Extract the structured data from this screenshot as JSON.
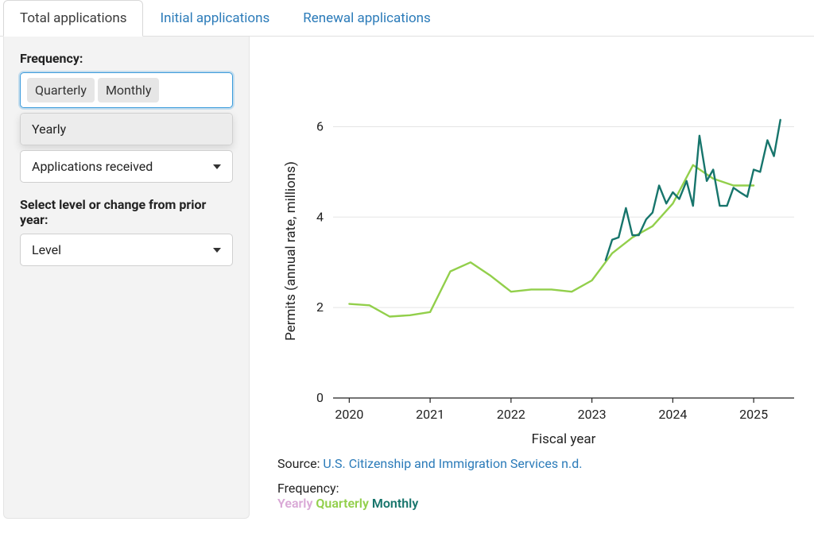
{
  "tabs": {
    "total": "Total applications",
    "initial": "Initial applications",
    "renewal": "Renewal applications"
  },
  "sidebar": {
    "frequency_label": "Frequency:",
    "chips": {
      "quarterly": "Quarterly",
      "monthly": "Monthly"
    },
    "dropdown_option": "Yearly",
    "series_select": "Applications received",
    "level_label": "Select level or change from prior year:",
    "level_value": "Level"
  },
  "chart": {
    "ylabel": "Permits (annual rate, millions)",
    "xlabel": "Fiscal year",
    "source_prefix": "Source: ",
    "source_link": "U.S. Citizenship and Immigration Services n.d.",
    "legend_label": "Frequency:",
    "legend_yearly": "Yearly",
    "legend_quarterly": "Quarterly",
    "legend_monthly": "Monthly"
  },
  "chart_data": {
    "type": "line",
    "xlabel": "Fiscal year",
    "ylabel": "Permits (annual rate, millions)",
    "x_ticks": [
      2020,
      2021,
      2022,
      2023,
      2024,
      2025
    ],
    "y_ticks": [
      0,
      2,
      4,
      6
    ],
    "xlim": [
      2019.8,
      2025.5
    ],
    "ylim": [
      0,
      6.5
    ],
    "series": [
      {
        "name": "Quarterly",
        "color": "#92cf4b",
        "x": [
          2020.0,
          2020.25,
          2020.5,
          2020.75,
          2021.0,
          2021.25,
          2021.5,
          2021.75,
          2022.0,
          2022.25,
          2022.5,
          2022.75,
          2023.0,
          2023.25,
          2023.5,
          2023.75,
          2024.0,
          2024.25,
          2024.5,
          2024.75,
          2025.0
        ],
        "values": [
          2.08,
          2.05,
          1.8,
          1.83,
          1.9,
          2.8,
          3.0,
          2.7,
          2.35,
          2.4,
          2.4,
          2.35,
          2.6,
          3.2,
          3.55,
          3.8,
          4.3,
          5.15,
          4.85,
          4.7,
          4.7
        ]
      },
      {
        "name": "Monthly",
        "color": "#17756c",
        "x": [
          2023.17,
          2023.25,
          2023.33,
          2023.42,
          2023.5,
          2023.58,
          2023.67,
          2023.75,
          2023.83,
          2023.92,
          2024.0,
          2024.08,
          2024.17,
          2024.25,
          2024.33,
          2024.42,
          2024.5,
          2024.58,
          2024.67,
          2024.75,
          2024.83,
          2024.92,
          2025.0,
          2025.08,
          2025.17,
          2025.25,
          2025.33
        ],
        "values": [
          3.05,
          3.5,
          3.55,
          4.2,
          3.6,
          3.6,
          3.95,
          4.1,
          4.7,
          4.3,
          4.55,
          4.4,
          4.8,
          4.25,
          5.8,
          4.8,
          5.05,
          4.25,
          4.25,
          4.65,
          4.55,
          4.45,
          5.05,
          5.0,
          5.7,
          5.35,
          6.15
        ]
      }
    ]
  }
}
